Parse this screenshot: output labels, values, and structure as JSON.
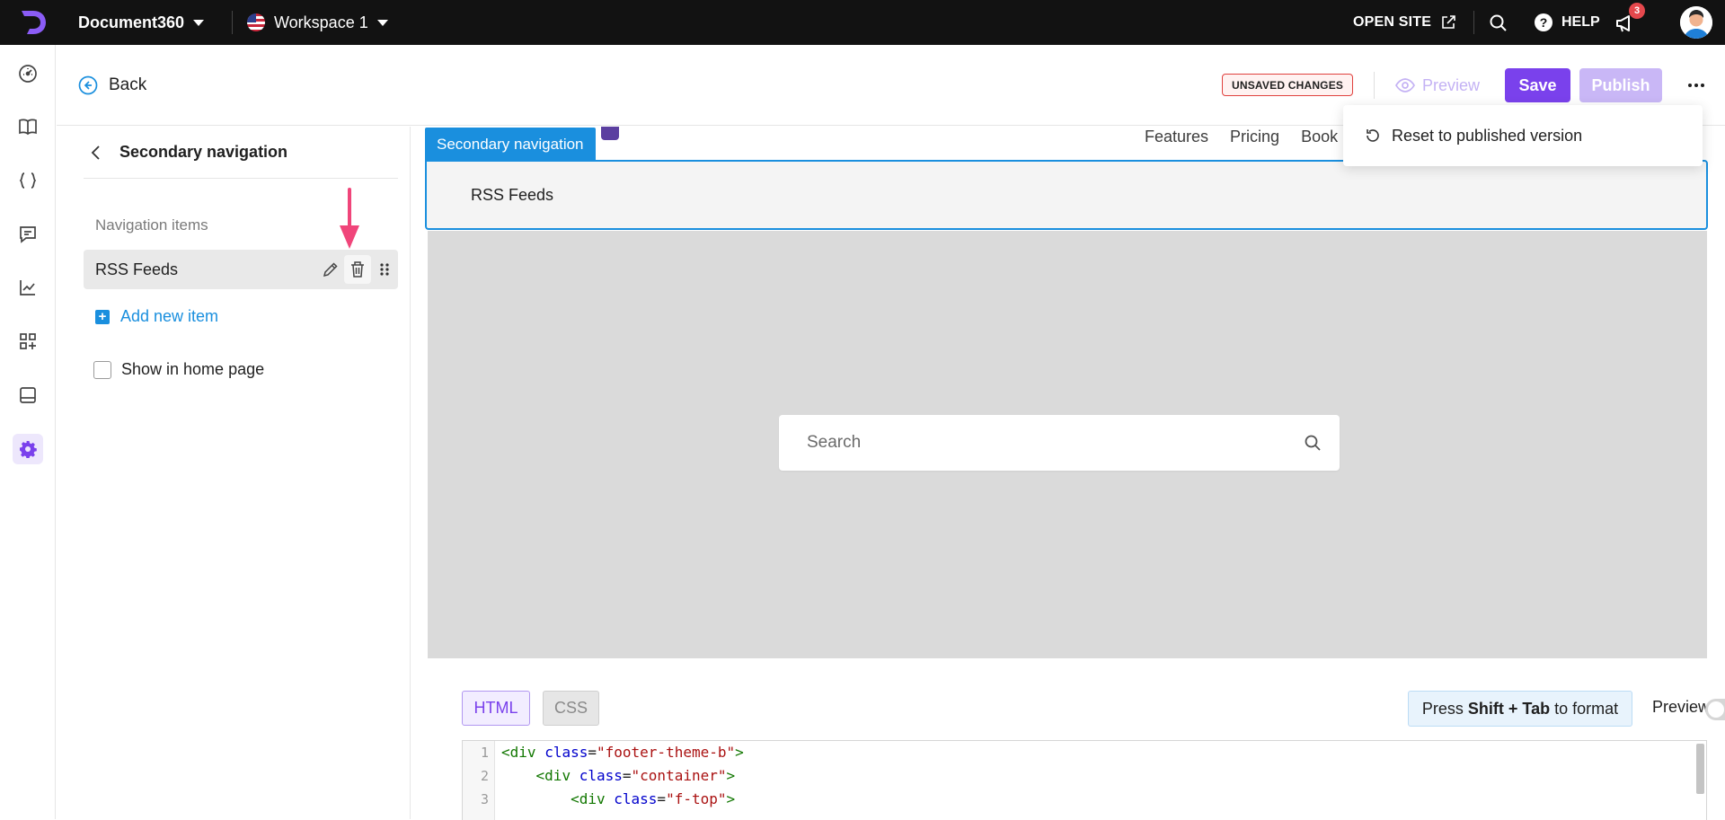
{
  "topbar": {
    "project_name": "Document360",
    "workspace": "Workspace 1",
    "open_site": "OPEN SITE",
    "help": "HELP",
    "notification_count": "3"
  },
  "rail": {
    "items": [
      "dashboard-icon",
      "documentation-icon",
      "api-docs-icon",
      "feedback-icon",
      "analytics-icon",
      "integrations-icon",
      "widgets-icon",
      "settings-icon"
    ],
    "active": "settings-icon"
  },
  "header": {
    "back_label": "Back",
    "unsaved_label": "UNSAVED CHANGES",
    "preview_label": "Preview",
    "save_label": "Save",
    "publish_label": "Publish"
  },
  "dropdown": {
    "reset_label": "Reset to published version"
  },
  "panel": {
    "title": "Secondary navigation",
    "section_label": "Navigation items",
    "items": [
      {
        "label": "RSS Feeds"
      }
    ],
    "add_item_label": "Add new item",
    "show_home_label": "Show in home page",
    "show_home_checked": false
  },
  "canvas": {
    "site_nav_links": [
      "Features",
      "Pricing",
      "Book"
    ],
    "section_tag": "Secondary navigation",
    "section_item": "RSS Feeds",
    "search_placeholder": "Search"
  },
  "editor": {
    "tabs": [
      "HTML",
      "CSS"
    ],
    "active_tab": "HTML",
    "format_hint": {
      "prefix": "Press",
      "keys": "Shift + Tab",
      "suffix": "to format"
    },
    "preview_toggle_label": "Preview",
    "preview_toggle_on": false,
    "line_numbers": [
      "1",
      "2",
      "3"
    ],
    "lines": [
      {
        "indent": "",
        "tag": "div",
        "attr": "class",
        "value": "\"footer-theme-b\""
      },
      {
        "indent": "    ",
        "tag": "div",
        "attr": "class",
        "value": "\"container\""
      },
      {
        "indent": "        ",
        "tag": "div",
        "attr": "class",
        "value": "\"f-top\""
      }
    ]
  },
  "colors": {
    "brand": "#7a41ec",
    "accent_blue": "#1a8fde",
    "annotation_arrow": "#f0457a",
    "topbar_bg": "#121212"
  }
}
